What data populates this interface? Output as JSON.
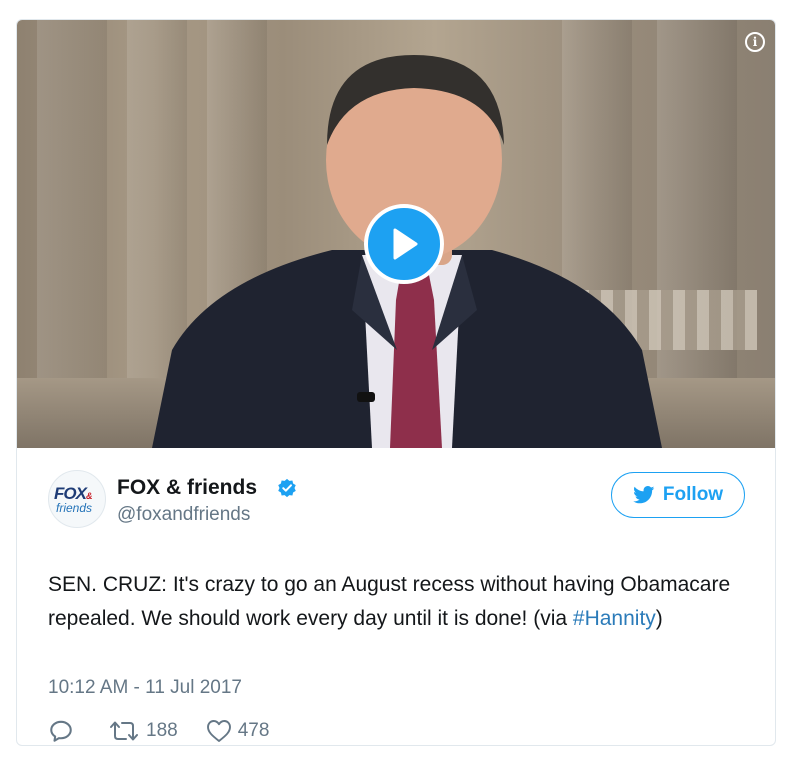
{
  "media": {
    "play_icon": "play-icon",
    "info_icon": "info-icon",
    "info_glyph": "i"
  },
  "tweet": {
    "avatar_text": "FOX",
    "avatar_amp": "&",
    "avatar_sub": "friends",
    "display_name": "FOX & friends",
    "verified_icon": "verified-badge-icon",
    "handle": "@foxandfriends",
    "follow_label": "Follow",
    "text_before": "SEN. CRUZ: It's crazy to go an August recess without having Obamacare repealed. We should work every day until it is done! (via ",
    "hashtag": "#Hannity",
    "text_after": ")",
    "timestamp": "10:12 AM - 11 Jul 2017",
    "actions": {
      "reply_count": "",
      "retweet_count": "188",
      "like_count": "478"
    }
  },
  "colors": {
    "accent": "#1da1f2",
    "text": "#14171a",
    "muted": "#657786",
    "link": "#2b7bb9"
  }
}
